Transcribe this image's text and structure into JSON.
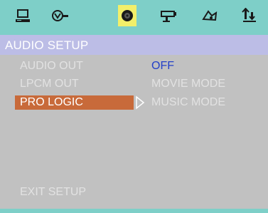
{
  "toolbar": {
    "items": [
      {
        "icon": "monitor-icon"
      },
      {
        "icon": "language-icon"
      },
      {
        "icon": "speaker-disc-icon",
        "active": true
      },
      {
        "icon": "video-camera-icon"
      },
      {
        "icon": "preferences-icon"
      },
      {
        "icon": "exit-icon"
      }
    ]
  },
  "title": "AUDIO SETUP",
  "menu": {
    "items": [
      {
        "label": "AUDIO OUT"
      },
      {
        "label": "LPCM OUT"
      },
      {
        "label": "PRO LOGIC",
        "selected": true
      }
    ],
    "exit_label": "EXIT SETUP"
  },
  "options": [
    {
      "label": "OFF",
      "current": true
    },
    {
      "label": "MOVIE MODE"
    },
    {
      "label": "MUSIC MODE"
    }
  ],
  "colors": {
    "toolbar_bg": "#7ecfc8",
    "title_bg": "#bcbde6",
    "panel_bg": "#c1c1c1",
    "selected_bg": "#c86a3a",
    "current_option": "#2340c8",
    "active_tool_bg": "#f2ef6a"
  }
}
